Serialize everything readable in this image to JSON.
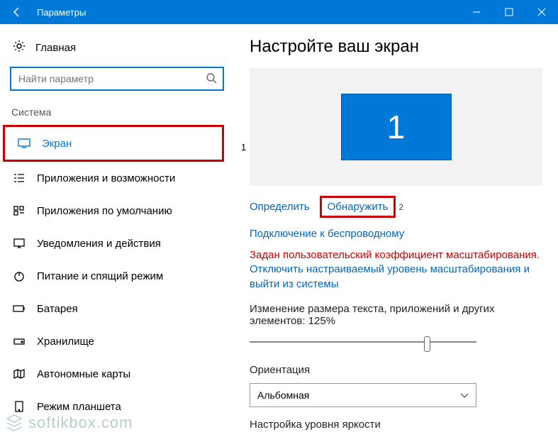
{
  "titlebar": {
    "title": "Параметры"
  },
  "sidebar": {
    "home": "Главная",
    "search_placeholder": "Найти параметр",
    "section": "Система",
    "items": [
      {
        "label": "Экран"
      },
      {
        "label": "Приложения и возможности"
      },
      {
        "label": "Приложения по умолчанию"
      },
      {
        "label": "Уведомления и действия"
      },
      {
        "label": "Питание и спящий режим"
      },
      {
        "label": "Батарея"
      },
      {
        "label": "Хранилище"
      },
      {
        "label": "Автономные карты"
      },
      {
        "label": "Режим планшета"
      }
    ]
  },
  "annotations": {
    "one": "1",
    "two": "2"
  },
  "main": {
    "heading": "Настройте ваш экран",
    "monitor_number": "1",
    "links": {
      "identify": "Определить",
      "detect": "Обнаружить",
      "wireless": "Подключение к беспроводному"
    },
    "warning": "Задан пользовательский коэффициент масштабирования.",
    "warning_link": "Отключить настраиваемый уровень масштабирования и выйти из системы",
    "scale_label": "Изменение размера текста, приложений и других элементов: 125%",
    "orientation_label": "Ориентация",
    "orientation_value": "Альбомная",
    "brightness_label": "Настройка уровня яркости"
  },
  "watermark": "softikbox.com"
}
